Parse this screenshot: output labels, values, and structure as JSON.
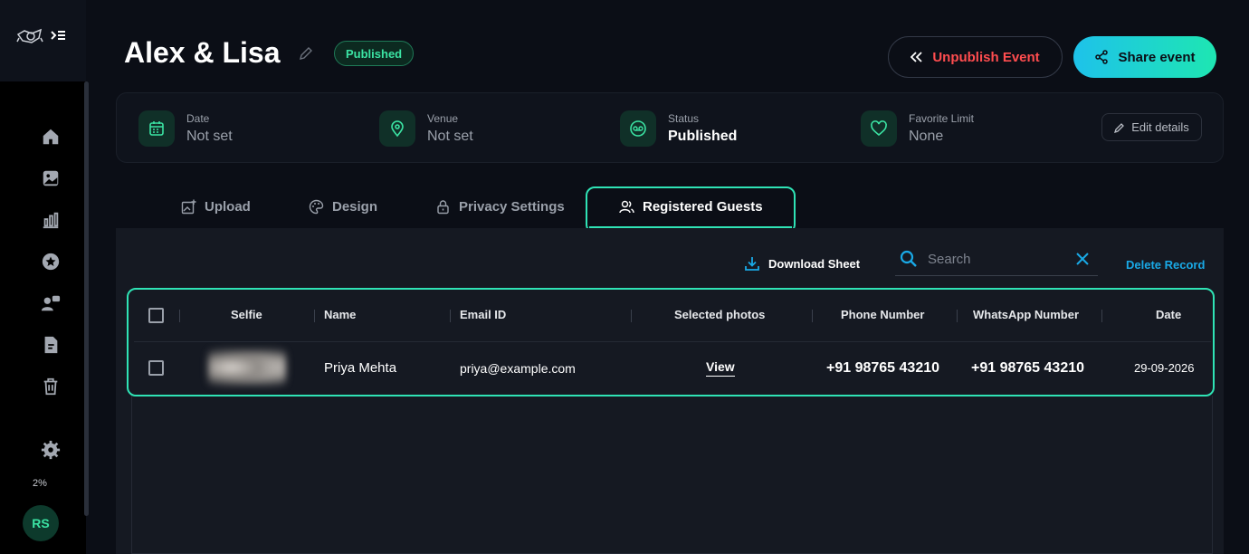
{
  "event": {
    "title": "Alex & Lisa",
    "status_badge": "Published"
  },
  "header": {
    "unpublish_label": "Unpublish Event",
    "share_label": "Share event"
  },
  "details": [
    {
      "label": "Date",
      "value": "Not set",
      "icon": "calendar-icon"
    },
    {
      "label": "Venue",
      "value": "Not set",
      "icon": "location-pin-icon"
    },
    {
      "label": "Status",
      "value": "Published",
      "icon": "status-icon"
    },
    {
      "label": "Favorite Limit",
      "value": "None",
      "icon": "heart-icon"
    }
  ],
  "edit_details_label": "Edit details",
  "tabs": [
    {
      "label": "Upload",
      "icon": "upload-image-icon"
    },
    {
      "label": "Design",
      "icon": "palette-icon"
    },
    {
      "label": "Privacy Settings",
      "icon": "lock-icon"
    },
    {
      "label": "Registered Guests",
      "icon": "users-icon",
      "active": true
    }
  ],
  "toolbar": {
    "download_label": "Download Sheet",
    "search_placeholder": "Search",
    "delete_label": "Delete Record"
  },
  "table": {
    "headers": [
      "Selfie",
      "Name",
      "Email ID",
      "Selected photos",
      "Phone Number",
      "WhatsApp Number",
      "Date"
    ],
    "rows": [
      {
        "name": "Priya Mehta",
        "email": "priya@example.com",
        "selected_photos": "View",
        "phone": "+91 98765 43210",
        "whatsapp": "+91 98765 43210",
        "date": "29-09-2026"
      }
    ]
  },
  "sidebar": {
    "items": [
      "home-icon",
      "gallery-icon",
      "analytics-icon",
      "star-icon",
      "users-group-icon",
      "document-icon",
      "trash-icon",
      "settings-icon"
    ],
    "usage": "2%",
    "avatar_initials": "RS"
  },
  "colors": {
    "accent": "#2fe3b5",
    "danger": "#ff4d4f",
    "link": "#19a9e6",
    "background": "#0b0e16"
  }
}
